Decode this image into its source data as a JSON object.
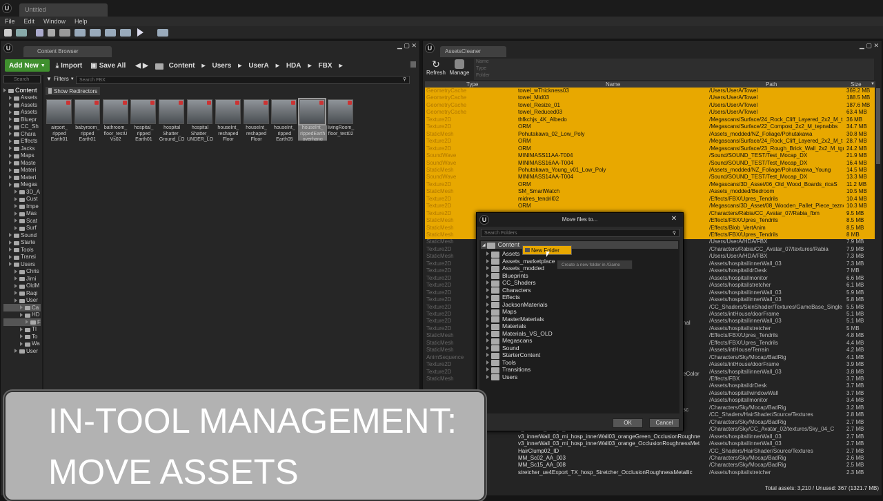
{
  "titlebar": {
    "tab": "Untitled"
  },
  "menu": [
    "File",
    "Edit",
    "Window",
    "Help"
  ],
  "cb": {
    "tab": "Content Browser",
    "add_new": "Add New",
    "import": "Import",
    "save_all": "Save All",
    "path": [
      "Content",
      "Users",
      "UserA",
      "HDA",
      "FBX"
    ],
    "search_tree_placeholder": "Search",
    "filters": "Filters",
    "search_placeholder": "Search FBX",
    "show_redirectors": "Show Redirectors",
    "tree": [
      "Content",
      "Assets",
      "Assets",
      "Assets",
      "Bluepr",
      "CC_Sh",
      "Chara",
      "Effects",
      "Jacks",
      "Maps",
      "Maste",
      "Materi",
      "Materi",
      "Megas",
      "3D_A",
      "Cust",
      "Impe",
      "Mas",
      "Scat",
      "Surf",
      "Sound",
      "Starte",
      "Tools",
      "Transi",
      "Users",
      "Chris",
      "Jimi",
      "OldM",
      "Raqi",
      "User",
      "Ca",
      "HD",
      "F",
      "TI",
      "To",
      "Wa",
      "User"
    ],
    "assets": [
      "airport_\nripped\nEarth01",
      "babyroom_\nripped\nEarth01",
      "bathroom_\nfloor_testU\nVs02",
      "hospital_\nripped\nEarth01",
      "hospital\nShatter_\nGround_LO",
      "hospital\nShatter_\nUNDER_LO",
      "houseInt_\nreshaped\nFloor",
      "houseInt_\nreshaped\nFloor",
      "houseInt_\nripped\nEarth05",
      "houseInt_\nrippedEarth\noverhang",
      "livingRoom_\nfloor_test02"
    ]
  },
  "ac": {
    "tab": "AssetsCleaner",
    "refresh": "Refresh",
    "manage": "Manage",
    "filter_labels": [
      "Name",
      "Type",
      "Folder"
    ],
    "columns": [
      "Type",
      "Name",
      "Path",
      "Size"
    ],
    "rows": [
      [
        "GeometryCache",
        "towel_wThickness03",
        "/Users/UserA/Towel",
        "369.2 MB",
        1
      ],
      [
        "GeometryCache",
        "towel_Mid03",
        "/Users/UserA/Towel",
        "188.5 MB",
        1
      ],
      [
        "GeometryCache",
        "towel_Resize_01",
        "/Users/UserA/Towel",
        "187.6 MB",
        1
      ],
      [
        "GeometryCache",
        "towel_Reduced03",
        "/Users/UserA/Towel",
        "63.4 MB",
        1
      ],
      [
        "Texture2D",
        "thfkchjs_4K_Albedo",
        "/Megascans/Surface/24_Rock_Cliff_Layered_2x2_M_t",
        "36 MB",
        1
      ],
      [
        "Texture2D",
        "ORM",
        "/Megascans/Surface/22_Compost_2x2_M_tepnabbs",
        "34.7 MB",
        1
      ],
      [
        "StaticMesh",
        "Pohutakawa_02_Low_Poly",
        "/Assets_modded/NZ_Foliage/Pohutakawa",
        "30.8 MB",
        1
      ],
      [
        "Texture2D",
        "ORM",
        "/Megascans/Surface/24_Rock_Cliff_Layered_2x2_M_t",
        "28.7 MB",
        1
      ],
      [
        "Texture2D",
        "ORM",
        "/Megascans/Surface/23_Rough_Brick_Wall_2x2_M_tgr",
        "24.2 MB",
        1
      ],
      [
        "SoundWave",
        "MINIMASS11AA-T004",
        "/Sound/SOUND_TEST/Test_Mocap_DX",
        "21.9 MB",
        1
      ],
      [
        "SoundWave",
        "MINIMASS16AA-T004",
        "/Sound/SOUND_TEST/Test_Mocap_DX",
        "16.4 MB",
        1
      ],
      [
        "StaticMesh",
        "Pohutakawa_Young_v01_Low_Poly",
        "/Assets_modded/NZ_Foliage/Pohutakawa_Young",
        "14.5 MB",
        1
      ],
      [
        "SoundWave",
        "MINIMASS14AA-T004",
        "/Sound/SOUND_TEST/Test_Mocap_DX",
        "13.3 MB",
        1
      ],
      [
        "Texture2D",
        "ORM",
        "/Megascans/3D_Asset/06_Old_Wood_Boards_ricaS",
        "11.2 MB",
        1
      ],
      [
        "StaticMesh",
        "SM_SmartWatch",
        "/Assets_modded/Bedroom",
        "10.5 MB",
        1
      ],
      [
        "Texture2D",
        "midres_tendril02",
        "/Effects/FBX/Upres_Tendrils",
        "10.4 MB",
        1
      ],
      [
        "Texture2D",
        "ORM",
        "/Megascans/3D_Asset/08_Wooden_Pallet_Piece_teznc",
        "10.3 MB",
        1
      ],
      [
        "Texture2D",
        "",
        "/Characters/Rabia/CC_Avatar_07/Rabia_fbm",
        "9.5 MB",
        1
      ],
      [
        "StaticMesh",
        "",
        "/Effects/FBX/Upres_Tendrils",
        "8.5 MB",
        1
      ],
      [
        "StaticMesh",
        "",
        "/Effects/Blob_VertAnim",
        "8.5 MB",
        1
      ],
      [
        "StaticMesh",
        "",
        "/Effects/FBX/Upres_Tendrils",
        "8 MB",
        1
      ],
      [
        "StaticMesh",
        "",
        "/Users/UserA/HDA/FBX",
        "7.9 MB",
        0
      ],
      [
        "Texture2D",
        "",
        "/Characters/Rabia/CC_Avatar_07/textures/Rabia",
        "7.9 MB",
        0
      ],
      [
        "StaticMesh",
        "",
        "/Users/UserA/HDA/FBX",
        "7.3 MB",
        0
      ],
      [
        "Texture2D",
        "",
        "/Assets/hospital/innerWall_03",
        "7.3 MB",
        0
      ],
      [
        "Texture2D",
        "",
        "/Assets/hospital/drDesk",
        "7 MB",
        0
      ],
      [
        "Texture2D",
        "",
        "/Assets/hospital/monitor",
        "6.6 MB",
        0
      ],
      [
        "Texture2D",
        "",
        "/Assets/hospital/stretcher",
        "6.1 MB",
        0
      ],
      [
        "Texture2D",
        "",
        "/Assets/hospital/innerWall_03",
        "5.9 MB",
        0
      ],
      [
        "Texture2D",
        "",
        "/Assets/hospital/innerWall_03",
        "5.8 MB",
        0
      ],
      [
        "Texture2D",
        "",
        "/CC_Shaders/SkinShader/Textures/GameBase_Single",
        "5.5 MB",
        0
      ],
      [
        "Texture2D",
        "",
        "/Assets/intHouse/doorFrame",
        "5.1 MB",
        0
      ],
      [
        "Texture2D",
        "",
        "/Assets/hospital/innerWall_03",
        "5.1 MB",
        0
      ],
      [
        "Texture2D",
        "",
        "/Assets/hospital/stretcher",
        "5 MB",
        0
      ],
      [
        "StaticMesh",
        "",
        "/Effects/FBX/Upres_Tendrils",
        "4.8 MB",
        0
      ],
      [
        "StaticMesh",
        "",
        "/Effects/FBX/Upres_Tendrils",
        "4.4 MB",
        0
      ],
      [
        "StaticMesh",
        "",
        "/Assets/intHouse/Terrain",
        "4.2 MB",
        0
      ],
      [
        "AnimSequence",
        "",
        "/Characters/Sky/Mocap/BadRig",
        "4.1 MB",
        0
      ],
      [
        "Texture2D",
        "",
        "/Assets/intHouse/doorFrame",
        "3.9 MB",
        0
      ],
      [
        "Texture2D",
        "",
        "/Assets/hospital/innerWall_03",
        "3.8 MB",
        0
      ],
      [
        "StaticMesh",
        "",
        "/Effects/FBX",
        "3.7 MB",
        0
      ],
      [
        "",
        "",
        "/Assets/hospital/drDesk",
        "3.7 MB",
        0
      ],
      [
        "",
        "",
        "/Assets/hospital/windowWall",
        "3.7 MB",
        0
      ],
      [
        "",
        "",
        "/Assets/hospital/monitor",
        "3.4 MB",
        0
      ],
      [
        "",
        "",
        "/Characters/Sky/Mocap/BadRig",
        "3.2 MB",
        0
      ],
      [
        "",
        "",
        "/CC_Shaders/HairShader/Source/Textures",
        "2.8 MB",
        0
      ],
      [
        "",
        "MM_Sc07_AD_005",
        "/Characters/Sky/Mocap/BadRig",
        "2.7 MB",
        0
      ],
      [
        "",
        "4_meshes_Merge_bump",
        "/Characters/Sky/CC_Avatar_02/textures/Sky_04_C",
        "2.7 MB",
        0
      ],
      [
        "",
        "v3_innerWall_03_mi_hosp_innerWall03_orangeGreen_OcclusionRoughne",
        "/Assets/hospital/innerWall_03",
        "2.7 MB",
        0
      ],
      [
        "",
        "v3_innerWall_03_mi_hosp_innerWall03_orange_OcclusionRoughnessMet",
        "/Assets/hospital/innerWall_03",
        "2.7 MB",
        0
      ],
      [
        "",
        "HairClump02_ID",
        "/CC_Shaders/HairShader/Source/Textures",
        "2.7 MB",
        0
      ],
      [
        "",
        "MM_Sc02_AA_003",
        "/Characters/Sky/Mocap/BadRig",
        "2.6 MB",
        0
      ],
      [
        "",
        "MM_Sc15_AA_008",
        "/Characters/Sky/Mocap/BadRig",
        "2.5 MB",
        0
      ],
      [
        "",
        "stretcher_ue4Export_TX_hosp_Stretcher_OcclusionRoughnessMetallic",
        "/Assets/hospital/stretcher",
        "2.3 MB",
        0
      ]
    ],
    "leak": {
      "nal": "nal",
      "color": "eColor",
      "sc": "sc"
    },
    "footer": "Total assets: 3,210 / Unused: 367 (1321.7 MB)"
  },
  "dialog": {
    "title": "Move files to...",
    "search_placeholder": "Search Folders",
    "root": "Content",
    "new_folder": "New Folder",
    "tooltip": "Create a new folder in /Game",
    "folders": [
      "Assets",
      "Assets_marketplace",
      "Assets_modded",
      "Blueprints",
      "CC_Shaders",
      "Characters",
      "Effects",
      "JacksonMaterials",
      "Maps",
      "MasterMaterials",
      "Materials",
      "Materials_VS_OLD",
      "Megascans",
      "Sound",
      "StarterContent",
      "Tools",
      "Transitions",
      "Users"
    ],
    "ok": "OK",
    "cancel": "Cancel"
  },
  "caption": {
    "line1": "IN-TOOL MANAGEMENT:",
    "line2": "MOVE ASSETS"
  }
}
